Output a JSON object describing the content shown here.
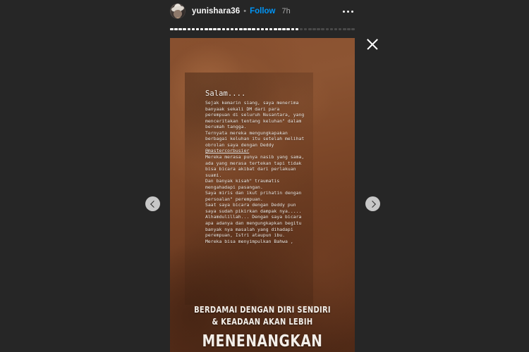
{
  "header": {
    "avatar_icon": "user-avatar",
    "username": "yunishara36",
    "separator": "•",
    "follow_label": "Follow",
    "timestamp": "7h",
    "more_icon": "more-options-icon"
  },
  "progress": {
    "total_segments": 43,
    "completed_segments": 30
  },
  "controls": {
    "close_icon": "close-icon",
    "prev_icon": "chevron-left-icon",
    "next_icon": "chevron-right-icon"
  },
  "story": {
    "background_color": "#7d4728",
    "greeting": "Salam....",
    "body": "Sejak kemarin siang, saya menerima banyaak sekali DM dari para perempuan di seluruh Nusantara, yang menceritakan tentang keluhan\" dalam berumah tangga.\nTernyata mereka mengungkapakan berbagai keluhan itu setelah melihat obrolan saya dengan Deddy\n",
    "mention": "@mastercorbusier",
    "body_continued": "\nMereka merasa punya nasib yang sama, ada yang merasa tertekan tapi tidak bisa bicara akibat dari perlakuan suami.\nDan banyak kisah\" traumatis mengahadapi pasangan.\nSaya miris dan ikut prihatin dengan persoalan\" perempuan.\nSaat saya bicara dengan Deddy pun saya sudah pikirkan dampak nya.....\nAlhamdulillah... Dengan saya bicara apa adanya dan mengungkapkan begitu banyak nya masalah yang dihadapi perempuan, Istri ataupun ibu.\nMereka bisa menyimpulkan Bahwa ,",
    "caption_line_1": "BERDAMAI DENGAN DIRI SENDIRI",
    "caption_line_2": "& KEADAAN AKAN LEBIH",
    "caption_line_3": "MENENANGKAN"
  },
  "colors": {
    "page_background": "#262626",
    "follow_blue": "#0095f6",
    "username_white": "#fafafa",
    "timestamp_gray": "#a8a8a8",
    "progress_active": "#ffffff",
    "progress_inactive": "#4a4a4a"
  }
}
